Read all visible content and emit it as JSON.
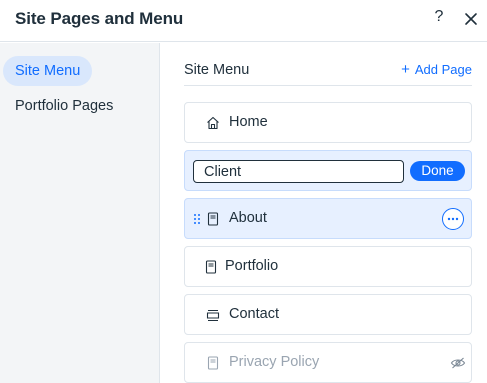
{
  "header": {
    "title": "Site Pages and Menu",
    "help_label": "?",
    "close_icon": "close-icon"
  },
  "sidebar": {
    "items": [
      {
        "label": "Site Menu",
        "active": true
      },
      {
        "label": "Portfolio Pages",
        "active": false
      }
    ]
  },
  "main": {
    "title": "Site Menu",
    "add_page": {
      "plus": "+",
      "label": "Add Page"
    }
  },
  "pages": [
    {
      "label": "Home",
      "icon": "home-icon"
    },
    {
      "editing": true,
      "input_value": "Client",
      "done_label": "Done"
    },
    {
      "label": "About",
      "icon": "page-icon",
      "selected": true,
      "drag_icon": "drag-handle-icon",
      "more_icon": "more-actions-icon"
    },
    {
      "label": "Portfolio",
      "icon": "page-icon"
    },
    {
      "label": "Contact",
      "icon": "contact-page-icon"
    },
    {
      "label": "Privacy Policy",
      "icon": "page-icon",
      "hidden": true,
      "status_icon": "hidden-eye-icon"
    }
  ],
  "colors": {
    "accent": "#116dff",
    "selected_bg": "#e7f0ff",
    "sidebar_bg": "#f3f5f7",
    "text": "#20303c",
    "muted_text": "#9aa5b1"
  }
}
